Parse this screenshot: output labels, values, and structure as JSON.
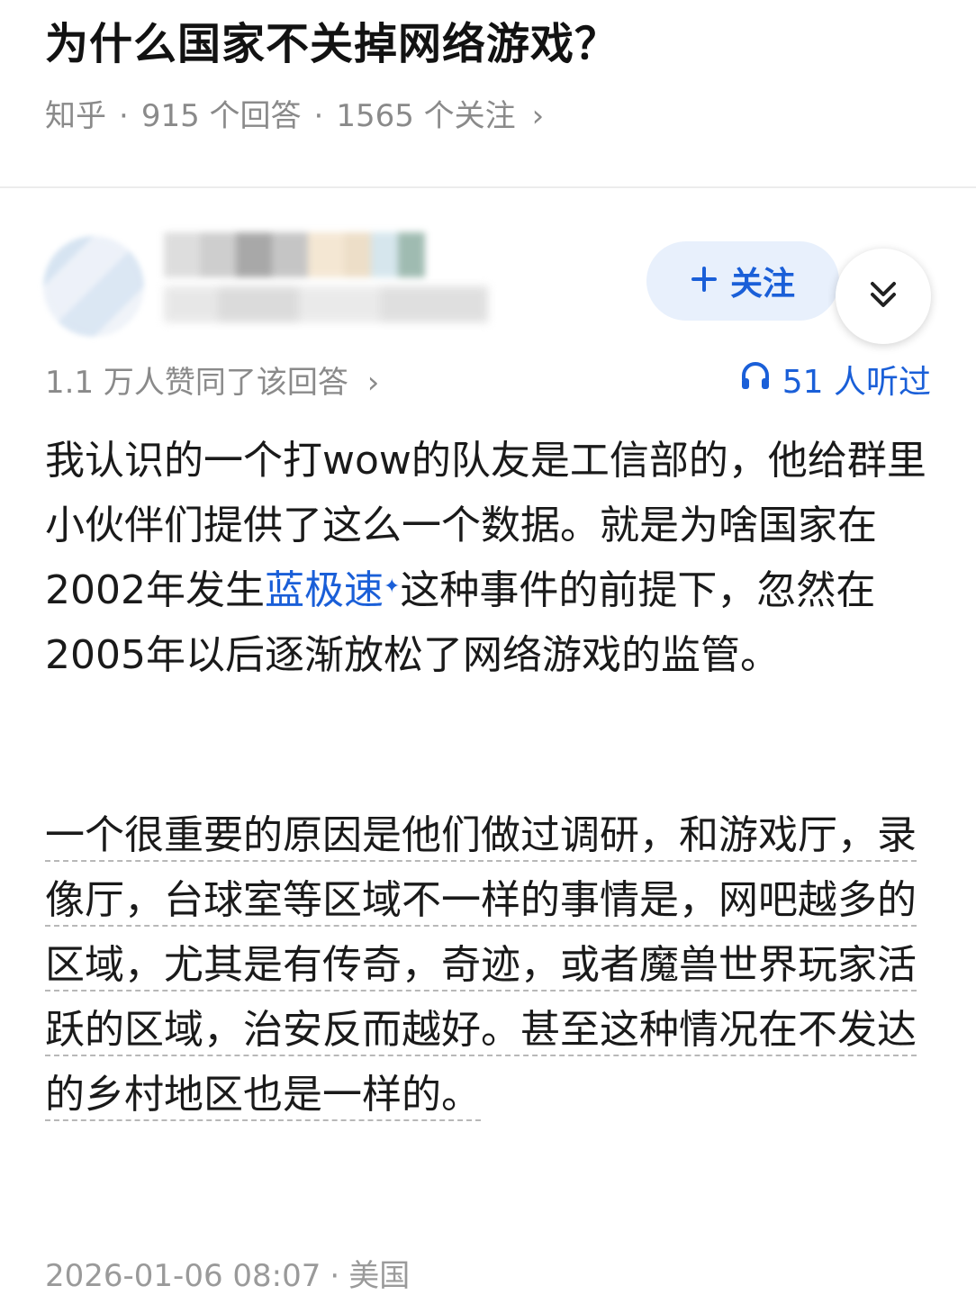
{
  "question": {
    "title": "为什么国家不关掉网络游戏？",
    "source": "知乎",
    "separator": "·",
    "answers_count": "915 个回答",
    "followers_count": "1565 个关注",
    "chevron": "›"
  },
  "author": {
    "follow_label": "关注",
    "follow_icon": "plus-icon",
    "more_icon": "double-chevron-down-icon"
  },
  "answer": {
    "votes_text": "1.1 万人赞同了该回答",
    "votes_chevron": "›",
    "listened_icon": "headphones-icon",
    "listened_text": "51 人听过",
    "p1_a": "我认识的一个打wow的队友是工信部的，他给群里小伙伴们提供了这么一个数据。就是为啥国家在2002年发生",
    "p1_link": "蓝极速",
    "p1_link_mark": "✦",
    "p1_b": "这种事件的前提下，忽然在2005年以后逐渐放松了网络游戏的监管。",
    "p2": "一个很重要的原因是他们做过调研，和游戏厅，录像厅，台球室等区域不一样的事情是，网吧越多的区域，尤其是有传奇，奇迹，或者魔兽世界玩家活跃的区域，治安反而越好。甚至这种情况在不发达的乡村地区也是一样的。"
  },
  "footer": {
    "datetime": "2026-01-06 08:07",
    "separator": "·",
    "location": "美国"
  },
  "colors": {
    "accent": "#1a5fd8",
    "muted": "#8a8a8a",
    "follow_bg": "#e8f0fc"
  }
}
